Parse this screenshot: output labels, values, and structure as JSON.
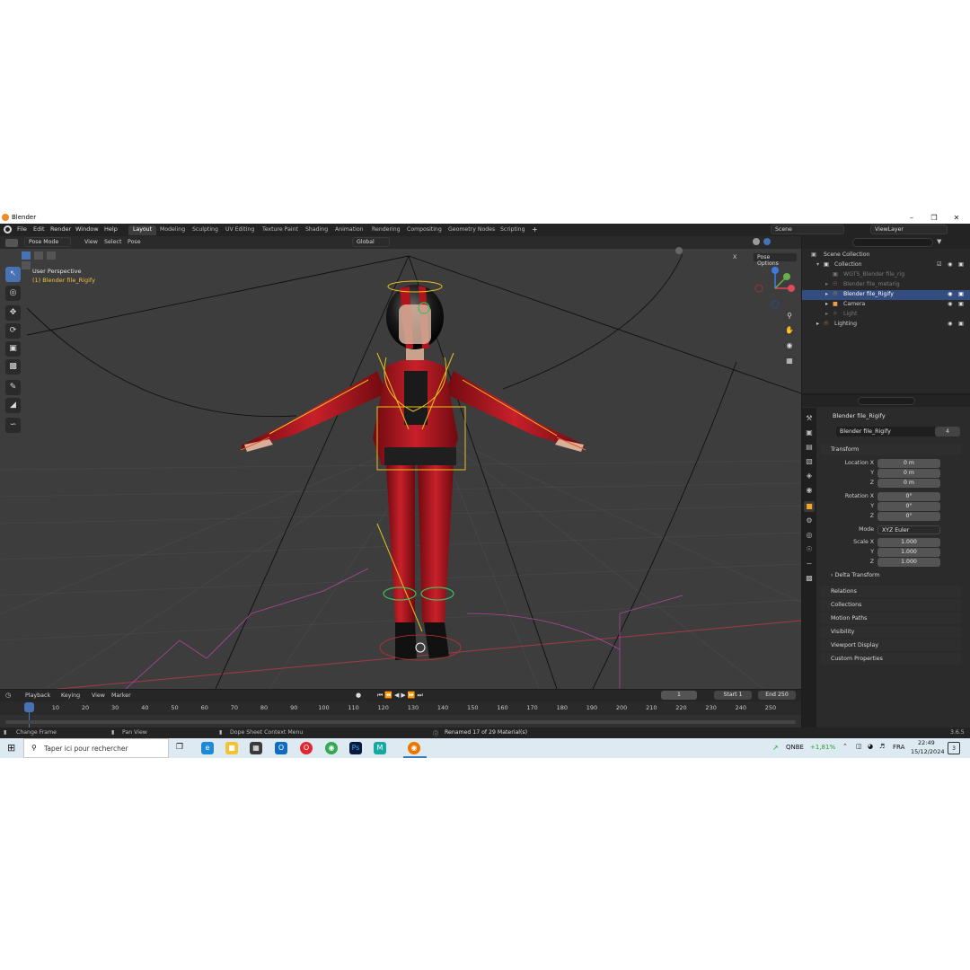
{
  "window": {
    "title": "Blender"
  },
  "menu": [
    "File",
    "Edit",
    "Render",
    "Window",
    "Help"
  ],
  "workspaces": [
    "Layout",
    "Modeling",
    "Sculpting",
    "UV Editing",
    "Texture Paint",
    "Shading",
    "Animation",
    "Rendering",
    "Compositing",
    "Geometry Nodes",
    "Scripting"
  ],
  "active_workspace": "Layout",
  "scene": "Scene",
  "view_layer": "ViewLayer",
  "viewport": {
    "mode": "Pose Mode",
    "menus": [
      "View",
      "Select",
      "Pose"
    ],
    "transform_orientation": "Global",
    "view_name": "User Perspective",
    "active_object": "(1) Blender file_Rigify",
    "pose_options": "Pose Options",
    "x_label": "X"
  },
  "outliner": {
    "scene_collection": "Scene Collection",
    "rows": [
      {
        "label": "Collection"
      },
      {
        "label": "WGTS_Blender file_rig"
      },
      {
        "label": "Blender file_metarig"
      },
      {
        "label": "Blender file_Rigify"
      },
      {
        "label": "Camera"
      },
      {
        "label": "Light"
      },
      {
        "label": "Lighting"
      }
    ]
  },
  "properties": {
    "object_name": "Blender file_Rigify",
    "data_name": "Blender file_Rigify",
    "users": "4",
    "transform_title": "Transform",
    "location": {
      "label": "Location X",
      "x": "0 m",
      "y": "0 m",
      "z": "0 m"
    },
    "rotation": {
      "label": "Rotation X",
      "x": "0°",
      "y": "0°",
      "z": "0°"
    },
    "mode_label": "Mode",
    "mode_value": "XYZ Euler",
    "scale": {
      "label": "Scale X",
      "x": "1.000",
      "y": "1.000",
      "z": "1.000"
    },
    "axis_y": "Y",
    "axis_z": "Z",
    "delta": "Delta Transform",
    "panels": [
      "Relations",
      "Collections",
      "Motion Paths",
      "Visibility",
      "Viewport Display",
      "Custom Properties"
    ]
  },
  "timeline": {
    "menus": [
      "Playback",
      "Keying",
      "View",
      "Marker"
    ],
    "current_frame": "1",
    "start_label": "Start",
    "start": "1",
    "end_label": "End",
    "end": "250",
    "ticks": [
      "1",
      "10",
      "20",
      "30",
      "40",
      "50",
      "60",
      "70",
      "80",
      "90",
      "100",
      "110",
      "120",
      "130",
      "140",
      "150",
      "160",
      "170",
      "180",
      "190",
      "200",
      "210",
      "220",
      "230",
      "240",
      "250"
    ]
  },
  "status": {
    "left": "Change Frame",
    "middle": "Pan View",
    "context": "Dope Sheet Context Menu",
    "message": "Renamed 17 of 29 Material(s)",
    "version": "3.6.5"
  },
  "taskbar": {
    "search_placeholder": "Taper ici pour rechercher",
    "stock": "QNBE",
    "stock_change": "+1,81%",
    "lang": "FRA",
    "time": "22:49",
    "date": "15/12/2024",
    "notif_count": "3"
  },
  "colors": {
    "accent": "#4772b3",
    "outfit": "#b0141c",
    "bone": "#e8c020",
    "selected": "#334d80"
  }
}
